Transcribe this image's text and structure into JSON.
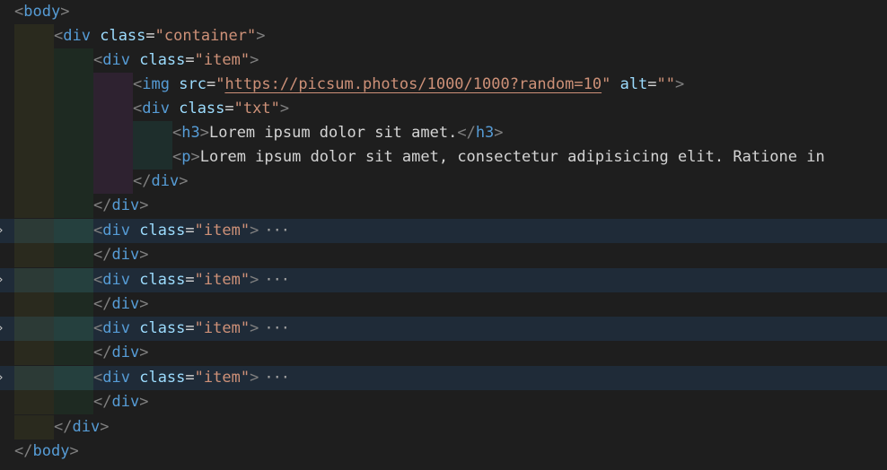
{
  "editor": {
    "lines": {
      "body_open": {
        "tag": "body"
      },
      "container_open": {
        "tag": "div",
        "attr": "class",
        "eq": "=",
        "value": "\"container\""
      },
      "item1_open": {
        "tag": "div",
        "attr": "class",
        "eq": "=",
        "value": "\"item\""
      },
      "img": {
        "tag": "img",
        "attr1": "src",
        "eq": "=",
        "q": "\"",
        "url": "https://picsum.photos/1000/1000?random=10",
        "attr2": "alt",
        "value2": "\"\""
      },
      "txt_open": {
        "tag": "div",
        "attr": "class",
        "eq": "=",
        "value": "\"txt\""
      },
      "h3": {
        "tag": "h3",
        "text": "Lorem ipsum dolor sit amet.",
        "close": "h3"
      },
      "p": {
        "tag": "p",
        "text": "Lorem ipsum dolor sit amet, consectetur adipisicing elit. Ratione in"
      },
      "txt_close": {
        "tag": "div"
      },
      "item1_close": {
        "tag": "div"
      },
      "item2_open": {
        "tag": "div",
        "attr": "class",
        "eq": "=",
        "value": "\"item\"",
        "ellipsis": "···"
      },
      "item2_close": {
        "tag": "div"
      },
      "item3_open": {
        "tag": "div",
        "attr": "class",
        "eq": "=",
        "value": "\"item\"",
        "ellipsis": "···"
      },
      "item3_close": {
        "tag": "div"
      },
      "item4_open": {
        "tag": "div",
        "attr": "class",
        "eq": "=",
        "value": "\"item\"",
        "ellipsis": "···"
      },
      "item4_close": {
        "tag": "div"
      },
      "item5_open": {
        "tag": "div",
        "attr": "class",
        "eq": "=",
        "value": "\"item\"",
        "ellipsis": "···"
      },
      "item5_close": {
        "tag": "div"
      },
      "container_close": {
        "tag": "div"
      },
      "body_close": {
        "tag": "body"
      }
    },
    "fold_icon": "chevron-right-icon",
    "colors": {
      "background": "#1e1e1e",
      "tag": "#569cd6",
      "attribute": "#9cdcfe",
      "string": "#ce9178",
      "text": "#d4d4d4",
      "punctuation": "#808080",
      "folded_line": "#1f2b38"
    }
  }
}
